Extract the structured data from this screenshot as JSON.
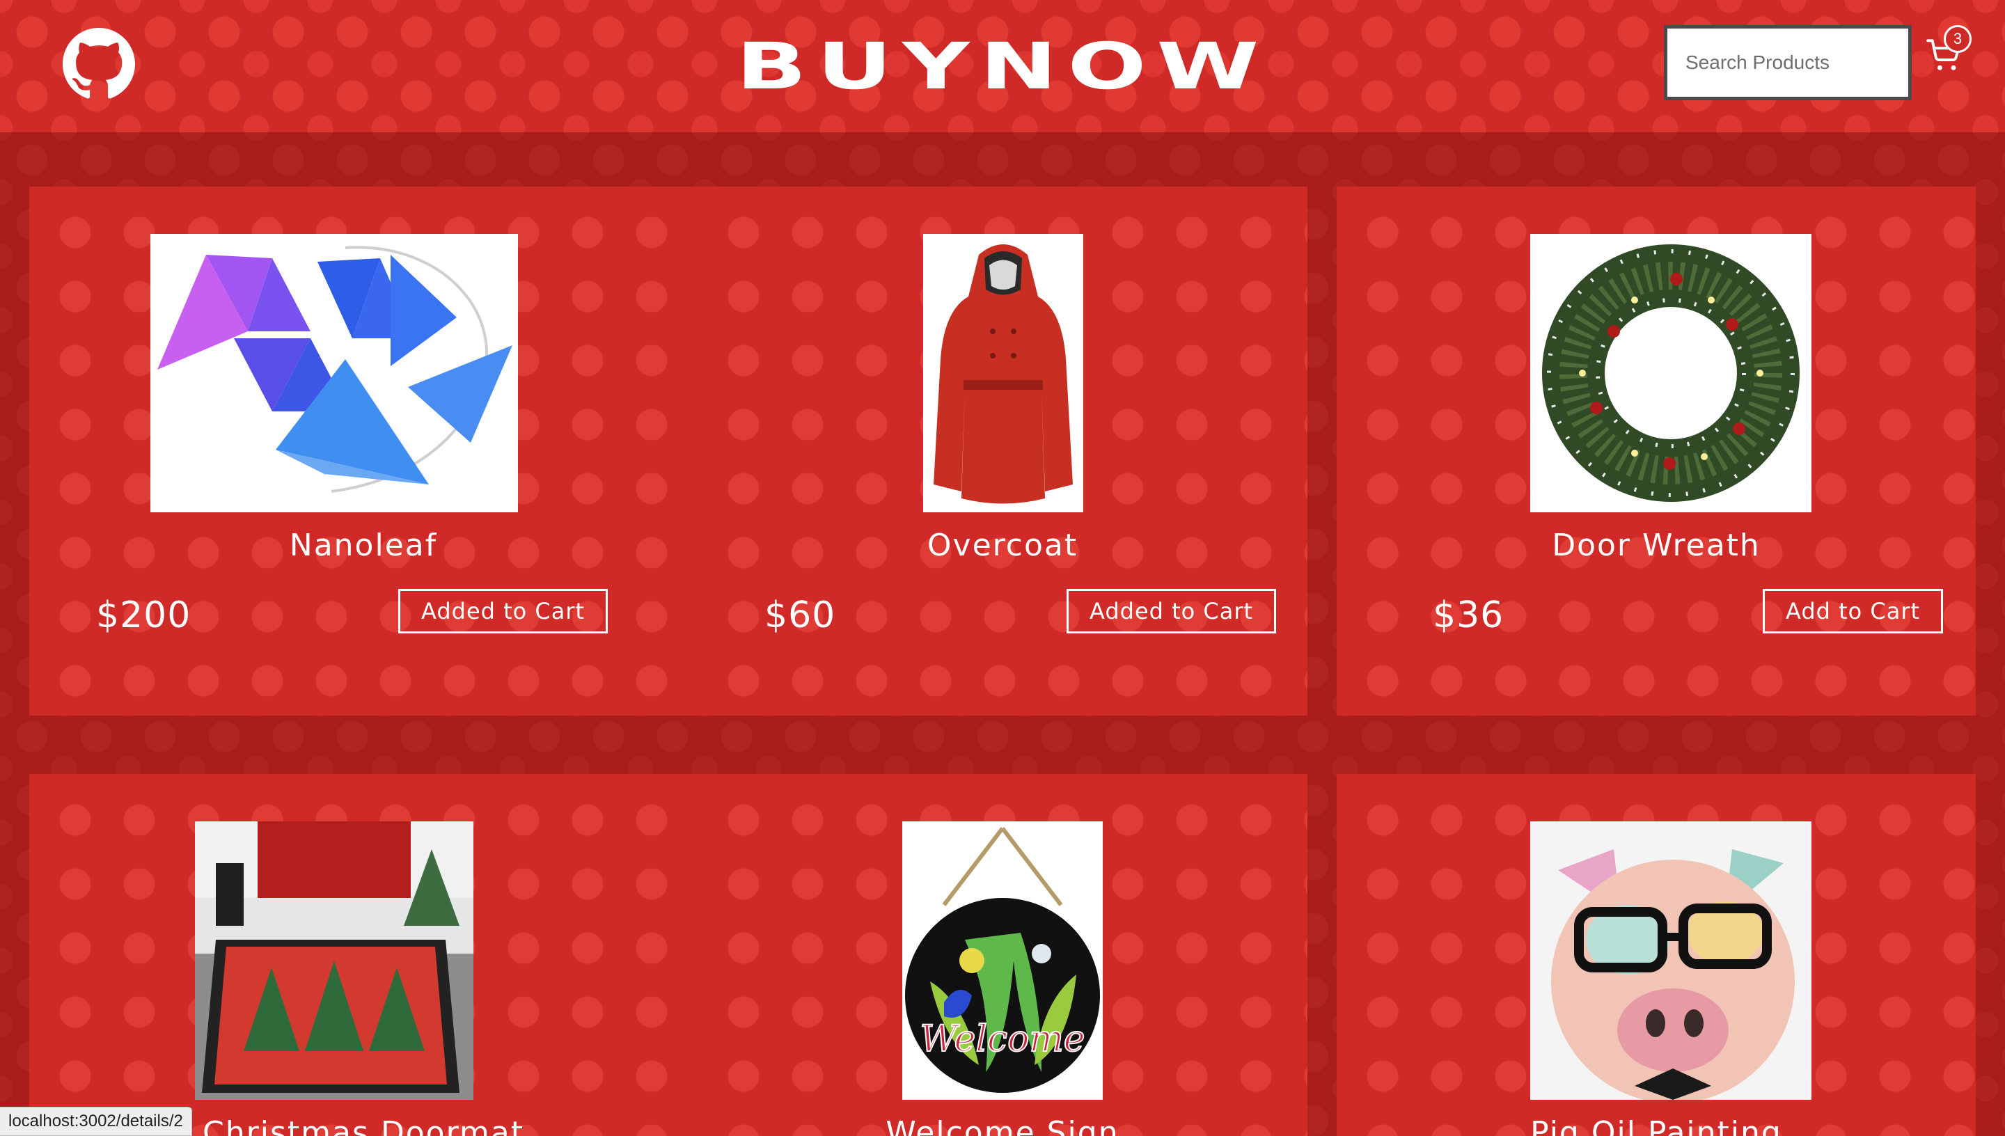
{
  "header": {
    "brand": "BUYNOW",
    "search_placeholder": "Search Products",
    "cart_count": "3"
  },
  "products": [
    {
      "name": "Nanoleaf",
      "price": "$200",
      "button": "Added to Cart"
    },
    {
      "name": "Overcoat",
      "price": "$60",
      "button": "Added to Cart"
    },
    {
      "name": "Door Wreath",
      "price": "$36",
      "button": "Add to Cart"
    },
    {
      "name": "Christmas Doormat",
      "price": "",
      "button": ""
    },
    {
      "name": "Welcome Sign",
      "price": "",
      "button": ""
    },
    {
      "name": "Pig Oil Painting",
      "price": "",
      "button": ""
    }
  ],
  "images": {
    "welcome_text": "Welcome"
  },
  "status_bar": {
    "url": "localhost:3002/details/2"
  },
  "colors": {
    "background": "#cf2a27",
    "accent": "#ffffff"
  }
}
